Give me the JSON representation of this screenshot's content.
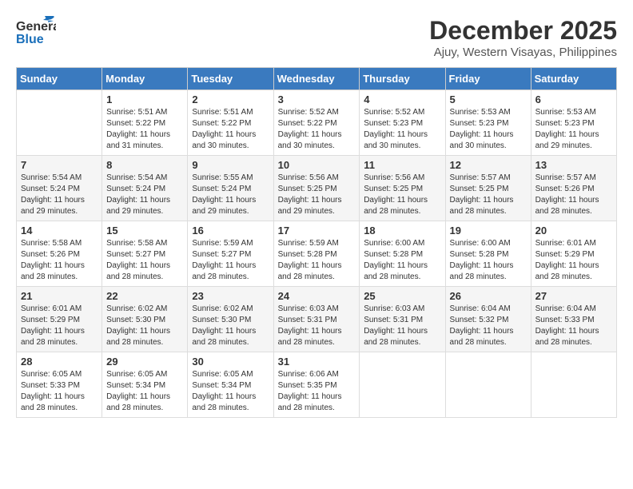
{
  "app": {
    "logo_general": "General",
    "logo_blue": "Blue"
  },
  "title": {
    "month_year": "December 2025",
    "location": "Ajuy, Western Visayas, Philippines"
  },
  "weekdays": [
    "Sunday",
    "Monday",
    "Tuesday",
    "Wednesday",
    "Thursday",
    "Friday",
    "Saturday"
  ],
  "weeks": [
    [
      {
        "day": "",
        "sunrise": "",
        "sunset": "",
        "daylight": ""
      },
      {
        "day": "1",
        "sunrise": "Sunrise: 5:51 AM",
        "sunset": "Sunset: 5:22 PM",
        "daylight": "Daylight: 11 hours and 31 minutes."
      },
      {
        "day": "2",
        "sunrise": "Sunrise: 5:51 AM",
        "sunset": "Sunset: 5:22 PM",
        "daylight": "Daylight: 11 hours and 30 minutes."
      },
      {
        "day": "3",
        "sunrise": "Sunrise: 5:52 AM",
        "sunset": "Sunset: 5:22 PM",
        "daylight": "Daylight: 11 hours and 30 minutes."
      },
      {
        "day": "4",
        "sunrise": "Sunrise: 5:52 AM",
        "sunset": "Sunset: 5:23 PM",
        "daylight": "Daylight: 11 hours and 30 minutes."
      },
      {
        "day": "5",
        "sunrise": "Sunrise: 5:53 AM",
        "sunset": "Sunset: 5:23 PM",
        "daylight": "Daylight: 11 hours and 30 minutes."
      },
      {
        "day": "6",
        "sunrise": "Sunrise: 5:53 AM",
        "sunset": "Sunset: 5:23 PM",
        "daylight": "Daylight: 11 hours and 29 minutes."
      }
    ],
    [
      {
        "day": "7",
        "sunrise": "Sunrise: 5:54 AM",
        "sunset": "Sunset: 5:24 PM",
        "daylight": "Daylight: 11 hours and 29 minutes."
      },
      {
        "day": "8",
        "sunrise": "Sunrise: 5:54 AM",
        "sunset": "Sunset: 5:24 PM",
        "daylight": "Daylight: 11 hours and 29 minutes."
      },
      {
        "day": "9",
        "sunrise": "Sunrise: 5:55 AM",
        "sunset": "Sunset: 5:24 PM",
        "daylight": "Daylight: 11 hours and 29 minutes."
      },
      {
        "day": "10",
        "sunrise": "Sunrise: 5:56 AM",
        "sunset": "Sunset: 5:25 PM",
        "daylight": "Daylight: 11 hours and 29 minutes."
      },
      {
        "day": "11",
        "sunrise": "Sunrise: 5:56 AM",
        "sunset": "Sunset: 5:25 PM",
        "daylight": "Daylight: 11 hours and 28 minutes."
      },
      {
        "day": "12",
        "sunrise": "Sunrise: 5:57 AM",
        "sunset": "Sunset: 5:25 PM",
        "daylight": "Daylight: 11 hours and 28 minutes."
      },
      {
        "day": "13",
        "sunrise": "Sunrise: 5:57 AM",
        "sunset": "Sunset: 5:26 PM",
        "daylight": "Daylight: 11 hours and 28 minutes."
      }
    ],
    [
      {
        "day": "14",
        "sunrise": "Sunrise: 5:58 AM",
        "sunset": "Sunset: 5:26 PM",
        "daylight": "Daylight: 11 hours and 28 minutes."
      },
      {
        "day": "15",
        "sunrise": "Sunrise: 5:58 AM",
        "sunset": "Sunset: 5:27 PM",
        "daylight": "Daylight: 11 hours and 28 minutes."
      },
      {
        "day": "16",
        "sunrise": "Sunrise: 5:59 AM",
        "sunset": "Sunset: 5:27 PM",
        "daylight": "Daylight: 11 hours and 28 minutes."
      },
      {
        "day": "17",
        "sunrise": "Sunrise: 5:59 AM",
        "sunset": "Sunset: 5:28 PM",
        "daylight": "Daylight: 11 hours and 28 minutes."
      },
      {
        "day": "18",
        "sunrise": "Sunrise: 6:00 AM",
        "sunset": "Sunset: 5:28 PM",
        "daylight": "Daylight: 11 hours and 28 minutes."
      },
      {
        "day": "19",
        "sunrise": "Sunrise: 6:00 AM",
        "sunset": "Sunset: 5:28 PM",
        "daylight": "Daylight: 11 hours and 28 minutes."
      },
      {
        "day": "20",
        "sunrise": "Sunrise: 6:01 AM",
        "sunset": "Sunset: 5:29 PM",
        "daylight": "Daylight: 11 hours and 28 minutes."
      }
    ],
    [
      {
        "day": "21",
        "sunrise": "Sunrise: 6:01 AM",
        "sunset": "Sunset: 5:29 PM",
        "daylight": "Daylight: 11 hours and 28 minutes."
      },
      {
        "day": "22",
        "sunrise": "Sunrise: 6:02 AM",
        "sunset": "Sunset: 5:30 PM",
        "daylight": "Daylight: 11 hours and 28 minutes."
      },
      {
        "day": "23",
        "sunrise": "Sunrise: 6:02 AM",
        "sunset": "Sunset: 5:30 PM",
        "daylight": "Daylight: 11 hours and 28 minutes."
      },
      {
        "day": "24",
        "sunrise": "Sunrise: 6:03 AM",
        "sunset": "Sunset: 5:31 PM",
        "daylight": "Daylight: 11 hours and 28 minutes."
      },
      {
        "day": "25",
        "sunrise": "Sunrise: 6:03 AM",
        "sunset": "Sunset: 5:31 PM",
        "daylight": "Daylight: 11 hours and 28 minutes."
      },
      {
        "day": "26",
        "sunrise": "Sunrise: 6:04 AM",
        "sunset": "Sunset: 5:32 PM",
        "daylight": "Daylight: 11 hours and 28 minutes."
      },
      {
        "day": "27",
        "sunrise": "Sunrise: 6:04 AM",
        "sunset": "Sunset: 5:33 PM",
        "daylight": "Daylight: 11 hours and 28 minutes."
      }
    ],
    [
      {
        "day": "28",
        "sunrise": "Sunrise: 6:05 AM",
        "sunset": "Sunset: 5:33 PM",
        "daylight": "Daylight: 11 hours and 28 minutes."
      },
      {
        "day": "29",
        "sunrise": "Sunrise: 6:05 AM",
        "sunset": "Sunset: 5:34 PM",
        "daylight": "Daylight: 11 hours and 28 minutes."
      },
      {
        "day": "30",
        "sunrise": "Sunrise: 6:05 AM",
        "sunset": "Sunset: 5:34 PM",
        "daylight": "Daylight: 11 hours and 28 minutes."
      },
      {
        "day": "31",
        "sunrise": "Sunrise: 6:06 AM",
        "sunset": "Sunset: 5:35 PM",
        "daylight": "Daylight: 11 hours and 28 minutes."
      },
      {
        "day": "",
        "sunrise": "",
        "sunset": "",
        "daylight": ""
      },
      {
        "day": "",
        "sunrise": "",
        "sunset": "",
        "daylight": ""
      },
      {
        "day": "",
        "sunrise": "",
        "sunset": "",
        "daylight": ""
      }
    ]
  ]
}
